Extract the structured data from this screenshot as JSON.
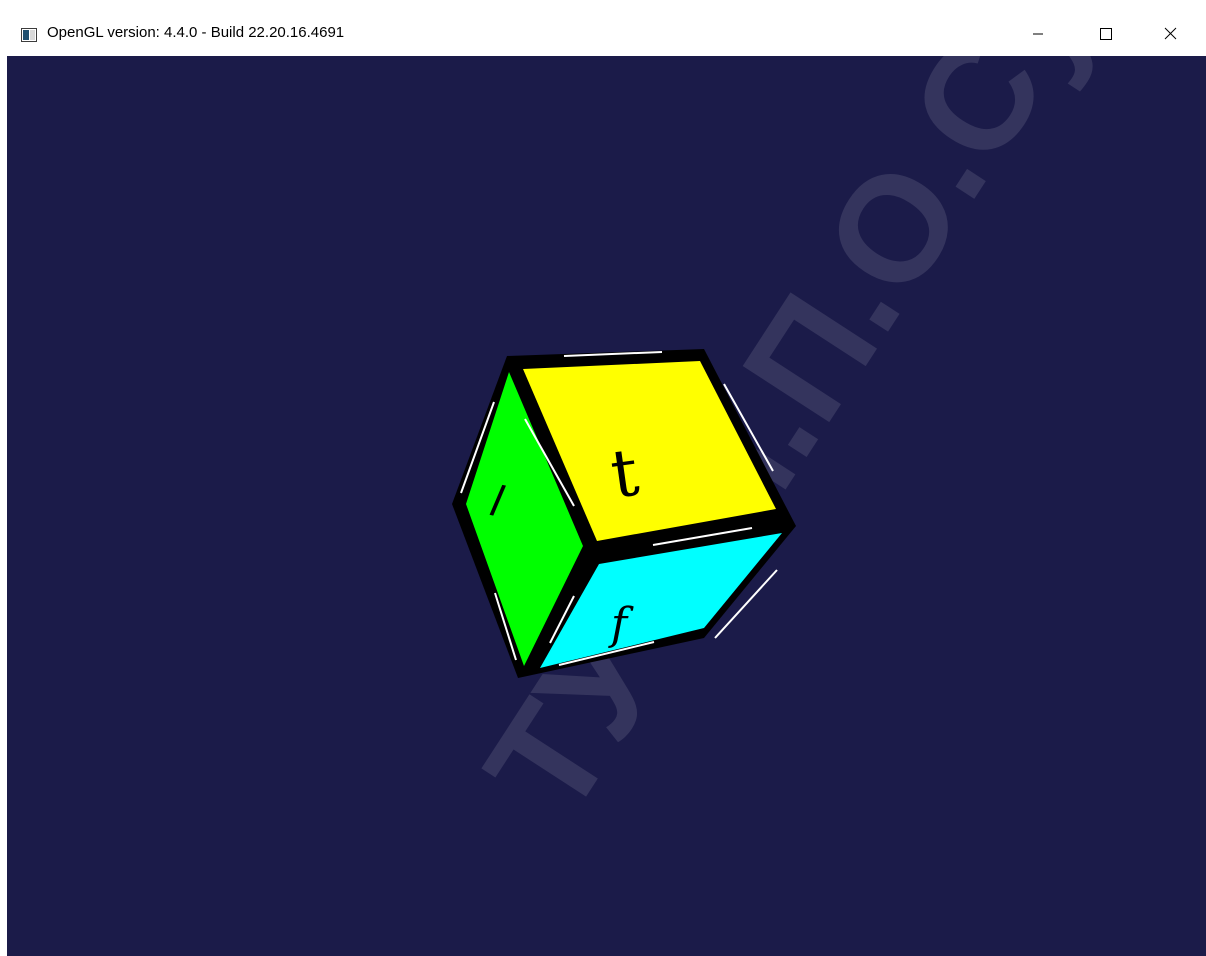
{
  "window": {
    "title": "OpenGL version: 4.4.0 - Build 22.20.16.4691",
    "controls": {
      "minimize_icon": "minimize-icon",
      "maximize_icon": "maximize-icon",
      "close_icon": "close-icon"
    }
  },
  "scene": {
    "background_color": "#1b1b49",
    "cube": {
      "top_face": {
        "label": "t",
        "color": "#ffff00"
      },
      "front_face": {
        "label": "f",
        "color": "#00ffff"
      },
      "left_face": {
        "label": "l",
        "color": "#00ff00"
      },
      "edge_color": "#000000",
      "highlight_color": "#ffffff"
    }
  },
  "watermark": {
    "text": "ГГТУ им.П.О.Сухого",
    "visible_fragment": "ТУ им.П.О.Сухо"
  }
}
